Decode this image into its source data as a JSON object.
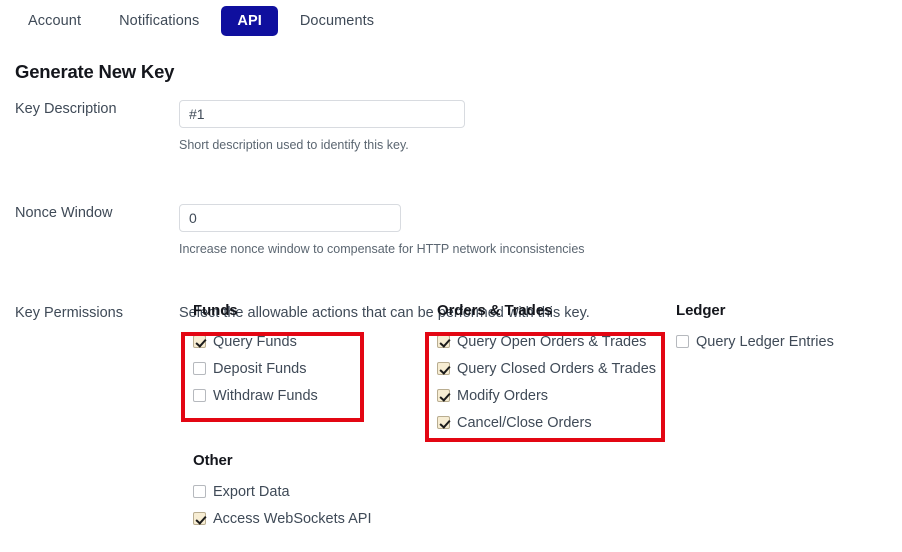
{
  "tabs": [
    {
      "label": "Account",
      "active": false
    },
    {
      "label": "Notifications",
      "active": false
    },
    {
      "label": "API",
      "active": true
    },
    {
      "label": "Documents",
      "active": false
    }
  ],
  "page": {
    "title": "Generate New Key"
  },
  "form": {
    "key_description": {
      "label": "Key Description",
      "value": "#1",
      "placeholder": "",
      "help": "Short description used to identify this key."
    },
    "nonce_window": {
      "label": "Nonce Window",
      "value": "0",
      "placeholder": "",
      "help": "Increase nonce window to compensate for HTTP network inconsistencies"
    },
    "key_permissions": {
      "label": "Key Permissions",
      "description": "Select the allowable actions that can be performed with this key."
    }
  },
  "permissions": {
    "funds": {
      "title": "Funds",
      "items": [
        {
          "label": "Query Funds",
          "checked": true
        },
        {
          "label": "Deposit Funds",
          "checked": false
        },
        {
          "label": "Withdraw Funds",
          "checked": false
        }
      ]
    },
    "orders": {
      "title": "Orders & Trades",
      "items": [
        {
          "label": "Query Open Orders & Trades",
          "checked": true
        },
        {
          "label": "Query Closed Orders & Trades",
          "checked": true
        },
        {
          "label": "Modify Orders",
          "checked": true
        },
        {
          "label": "Cancel/Close Orders",
          "checked": true
        }
      ]
    },
    "ledger": {
      "title": "Ledger",
      "items": [
        {
          "label": "Query Ledger Entries",
          "checked": false
        }
      ]
    },
    "other": {
      "title": "Other",
      "items": [
        {
          "label": "Export Data",
          "checked": false
        },
        {
          "label": "Access WebSockets API",
          "checked": true
        }
      ]
    }
  },
  "annotations": {
    "color": "#e30613",
    "boxes": [
      "funds-permissions-group",
      "orders-trades-permissions-group"
    ]
  },
  "colors": {
    "accent": "#0f0f9e",
    "text": "#3f4a57",
    "heading": "#14161c",
    "checkbox_checked_fill": "#f7edd3",
    "annotation_red": "#e30613"
  }
}
